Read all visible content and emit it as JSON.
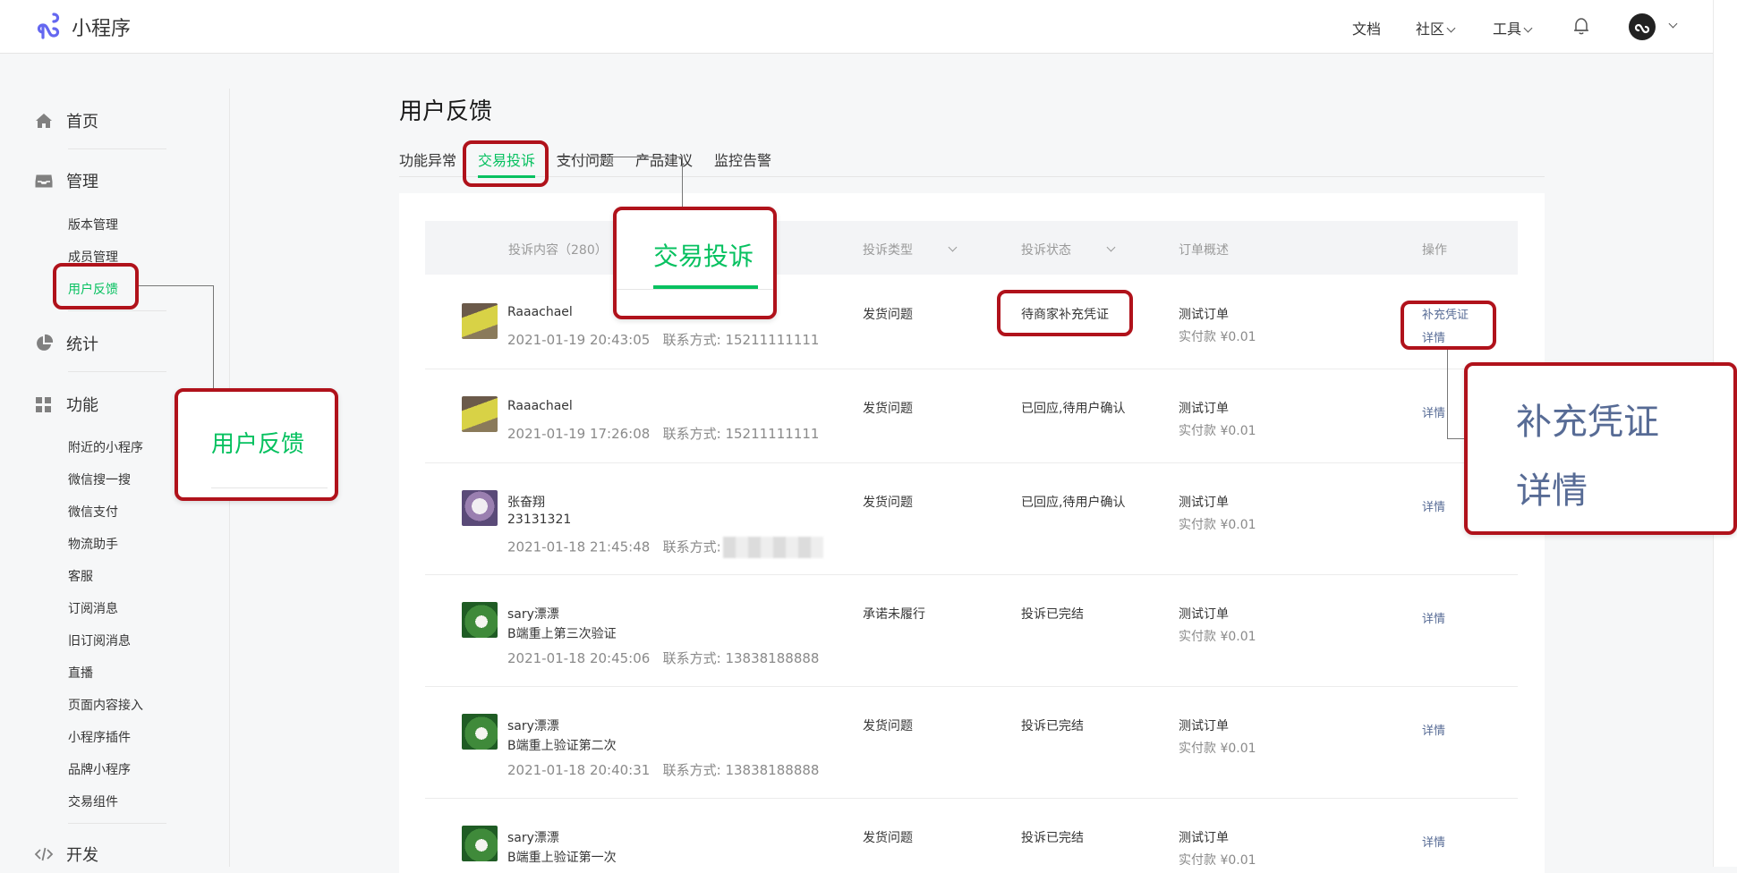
{
  "header": {
    "app_name": "小程序",
    "nav": [
      "文档",
      "社区",
      "工具"
    ]
  },
  "sidebar": {
    "sections": [
      {
        "label": "首页",
        "icon": "home-icon"
      },
      {
        "label": "管理",
        "icon": "inbox-icon",
        "items": [
          "版本管理",
          "成员管理",
          "用户反馈"
        ]
      },
      {
        "label": "统计",
        "icon": "pie-chart-icon"
      },
      {
        "label": "功能",
        "icon": "grid-icon",
        "items": [
          "附近的小程序",
          "微信搜一搜",
          "微信支付",
          "物流助手",
          "客服",
          "订阅消息",
          "旧订阅消息",
          "直播",
          "页面内容接入",
          "小程序插件",
          "品牌小程序",
          "交易组件"
        ]
      },
      {
        "label": "开发",
        "icon": "code-icon"
      }
    ],
    "active_item": "用户反馈"
  },
  "page": {
    "title": "用户反馈",
    "tabs": [
      "功能异常",
      "交易投诉",
      "支付问题",
      "产品建议",
      "监控告警"
    ],
    "active_tab": "交易投诉"
  },
  "table": {
    "headers": {
      "content": "投诉内容（280）",
      "type": "投诉类型",
      "status": "投诉状态",
      "order": "订单概述",
      "action": "操作"
    },
    "contact_label": "联系方式:",
    "rows": [
      {
        "name": "Raaachael",
        "text": "",
        "time": "2021-01-19 20:43:05",
        "contact": "15211111111",
        "type": "发货问题",
        "status": "待商家补充凭证",
        "order": "测试订单",
        "paid": "实付款 ¥0.01",
        "actions": [
          "补充凭证",
          "详情"
        ]
      },
      {
        "name": "Raaachael",
        "text": "",
        "time": "2021-01-19 17:26:08",
        "contact": "15211111111",
        "type": "发货问题",
        "status": "已回应,待用户确认",
        "order": "测试订单",
        "paid": "实付款 ¥0.01",
        "actions": [
          "详情"
        ]
      },
      {
        "name": "张奋翔",
        "text": "23131321",
        "time": "2021-01-18 21:45:48",
        "contact": "",
        "type": "发货问题",
        "status": "已回应,待用户确认",
        "order": "测试订单",
        "paid": "实付款 ¥0.01",
        "actions": [
          "详情"
        ]
      },
      {
        "name": "sary漂漂",
        "text": "B端重上第三次验证",
        "time": "2021-01-18 20:45:06",
        "contact": "13838188888",
        "type": "承诺未履行",
        "status": "投诉已完结",
        "order": "测试订单",
        "paid": "实付款 ¥0.01",
        "actions": [
          "详情"
        ]
      },
      {
        "name": "sary漂漂",
        "text": "B端重上验证第二次",
        "time": "2021-01-18 20:40:31",
        "contact": "13838188888",
        "type": "发货问题",
        "status": "投诉已完结",
        "order": "测试订单",
        "paid": "实付款 ¥0.01",
        "actions": [
          "详情"
        ]
      },
      {
        "name": "sary漂漂",
        "text": "B端重上验证第一次",
        "time": "",
        "contact": "",
        "type": "发货问题",
        "status": "投诉已完结",
        "order": "测试订单",
        "paid": "实付款 ¥0.01",
        "actions": [
          "详情"
        ]
      }
    ]
  },
  "callouts": {
    "sidebar": "用户反馈",
    "tab": "交易投诉",
    "action_1": "补充凭证",
    "action_2": "详情"
  },
  "colors": {
    "accent": "#07c160",
    "link": "#576b95",
    "callout_border": "#b0121b"
  }
}
